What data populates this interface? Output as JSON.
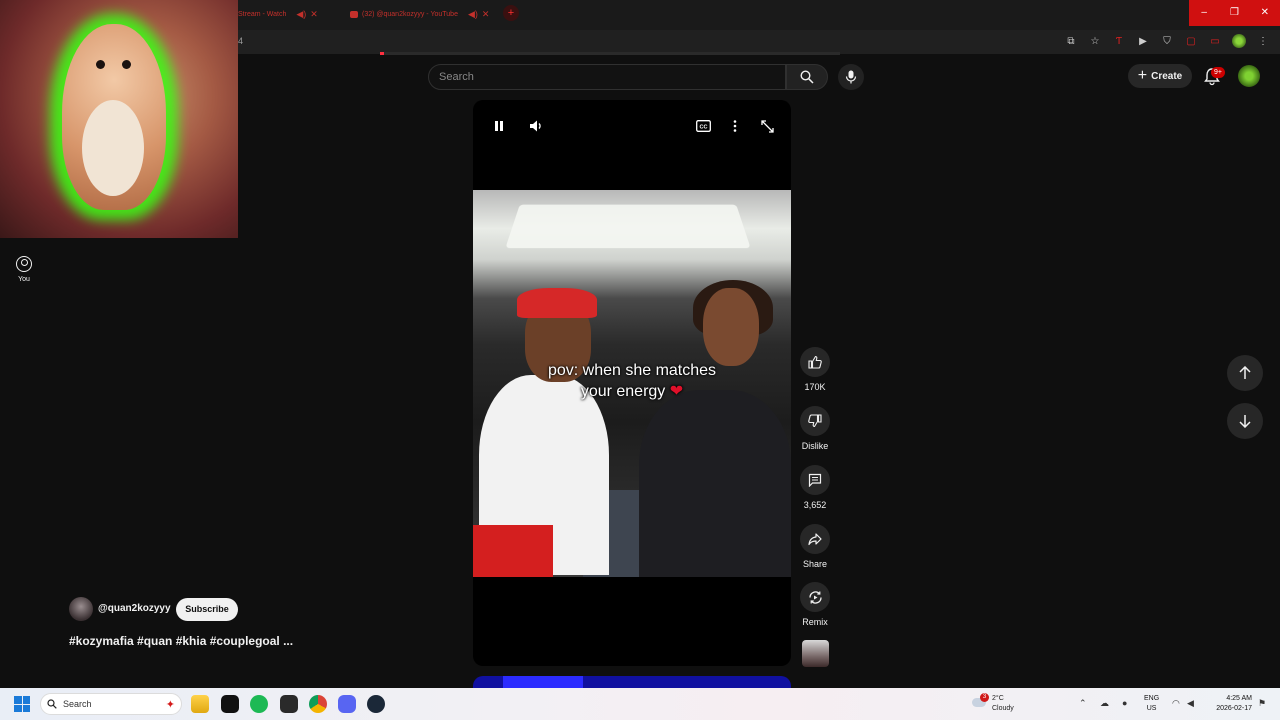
{
  "browser": {
    "tabs": [
      {
        "label": "Stream - Watch"
      },
      {
        "label": "(32) @quan2kozyyy - YouTube"
      }
    ],
    "new_tab": "+",
    "url": "4",
    "window_controls": {
      "minimize": "–",
      "restore": "❐",
      "close": "✕"
    }
  },
  "sidebar": {
    "you_label": "You"
  },
  "header": {
    "search_placeholder": "Search",
    "create_label": "Create",
    "notifications_badge": "9+"
  },
  "player": {
    "caption_line1": "pov: when she matches",
    "caption_line2": "your energy",
    "caption_emoji": "❤"
  },
  "actions": {
    "likes": "170K",
    "dislike_label": "Dislike",
    "comments": "3,652",
    "share_label": "Share",
    "remix_label": "Remix"
  },
  "channel": {
    "handle": "@quan2kozyyy",
    "subscribe_label": "Subscribe",
    "description": "#kozymafia #quan #khia #couplegoal ..."
  },
  "taskbar": {
    "search_label": "Search",
    "weather_temp": "2°C",
    "weather_desc": "Cloudy",
    "weather_badge": "3",
    "lang_line1": "ENG",
    "lang_line2": "US",
    "time": "4:25 AM",
    "date": "2026-02-17"
  },
  "colors": {
    "accent_red": "#ff0000",
    "background": "#0f0f0f",
    "chip": "#272727"
  }
}
